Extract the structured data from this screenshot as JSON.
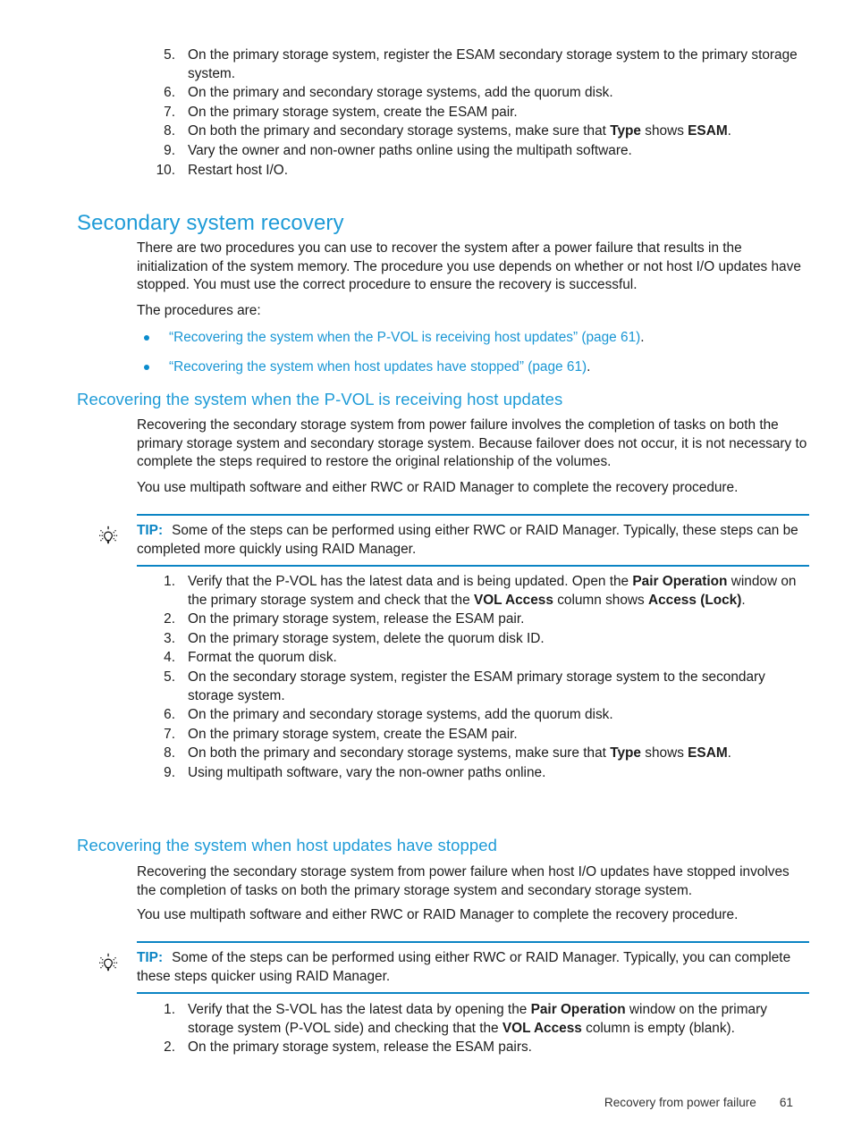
{
  "page": {
    "number": "61",
    "footer_text": "Recovery from power failure"
  },
  "top_list": {
    "items": [
      {
        "num": "5.",
        "html": "On the primary storage system, register the ESAM secondary storage system to the primary storage system."
      },
      {
        "num": "6.",
        "html": "On the primary and secondary storage systems, add the quorum disk."
      },
      {
        "num": "7.",
        "html": "On the primary storage system, create the ESAM pair."
      },
      {
        "num": "8.",
        "html": "On both the primary and secondary storage systems, make sure that <b>Type</b> shows <b>ESAM</b>."
      },
      {
        "num": "9.",
        "html": "Vary the owner and non-owner paths online using the multipath software."
      },
      {
        "num": "10.",
        "html": "Restart host I/O."
      }
    ]
  },
  "section": {
    "heading": "Secondary system recovery",
    "intro_paragraph": "There are two procedures you can use to recover the system after a power failure that results in the initialization of the system memory. The procedure you use depends on whether or not host I/O updates have stopped. You must use the correct procedure to ensure the recovery is successful.",
    "procedures_lead": "The procedures are:",
    "procedure_links": [
      {
        "text": "“Recovering the system when the P-VOL is receiving host updates” (page 61)",
        "suffix": "."
      },
      {
        "text": "“Recovering the system when host updates have stopped” (page 61)",
        "suffix": "."
      }
    ]
  },
  "subsection_pvol": {
    "heading": "Recovering the system when the P-VOL is receiving host updates",
    "paragraph1": "Recovering the secondary storage system from power failure involves the completion of tasks on both the primary storage system and secondary storage system. Because failover does not occur, it is not necessary to complete the steps required to restore the original relationship of the volumes.",
    "paragraph2": "You use multipath software and either RWC or RAID Manager to complete the recovery procedure.",
    "tip": {
      "label": "TIP:",
      "html": "Some of the steps can be performed using either RWC or RAID Manager. Typically, these steps can be completed more quickly using RAID Manager."
    },
    "steps": [
      {
        "num": "1.",
        "html": "Verify that the P-VOL has the latest data and is being updated. Open the <b>Pair Operation</b> window on the primary storage system and check that the <b>VOL Access</b> column shows <b>Access (Lock)</b>."
      },
      {
        "num": "2.",
        "html": "On the primary storage system, release the ESAM pair."
      },
      {
        "num": "3.",
        "html": "On the primary storage system, delete the quorum disk ID."
      },
      {
        "num": "4.",
        "html": "Format the quorum disk."
      },
      {
        "num": "5.",
        "html": "On the secondary storage system, register the ESAM primary storage system to the secondary storage system."
      },
      {
        "num": "6.",
        "html": "On the primary and secondary storage systems, add the quorum disk."
      },
      {
        "num": "7.",
        "html": "On the primary storage system, create the ESAM pair."
      },
      {
        "num": "8.",
        "html": "On both the primary and secondary storage systems, make sure that <b>Type</b> shows <b>ESAM</b>."
      },
      {
        "num": "9.",
        "html": "Using multipath software, vary the non-owner paths online."
      }
    ]
  },
  "subsection_stopped": {
    "heading": "Recovering the system when host updates have stopped",
    "paragraph1": "Recovering the secondary storage system from power failure when host I/O updates have stopped involves the completion of tasks on both the primary storage system and secondary storage system.",
    "paragraph2": "You use multipath software and either RWC or RAID Manager to complete the recovery procedure.",
    "tip": {
      "label": "TIP:",
      "html": "Some of the steps can be performed using either RWC or RAID Manager. Typically, you can complete these steps quicker using RAID Manager."
    },
    "steps": [
      {
        "num": "1.",
        "html": "Verify that the S-VOL has the latest data by opening the <b>Pair Operation</b> window on the primary storage system (P-VOL side) and checking that the <b>VOL Access</b> column is empty (blank)."
      },
      {
        "num": "2.",
        "html": "On the primary storage system, release the ESAM pairs."
      }
    ]
  },
  "icons": {
    "tip_icon": "lightbulb-icon"
  },
  "colors": {
    "heading_blue": "#1e9bd7",
    "rule_blue": "#0b84c4",
    "link_blue": "#1996d4",
    "body_black": "#1c1c1c"
  }
}
